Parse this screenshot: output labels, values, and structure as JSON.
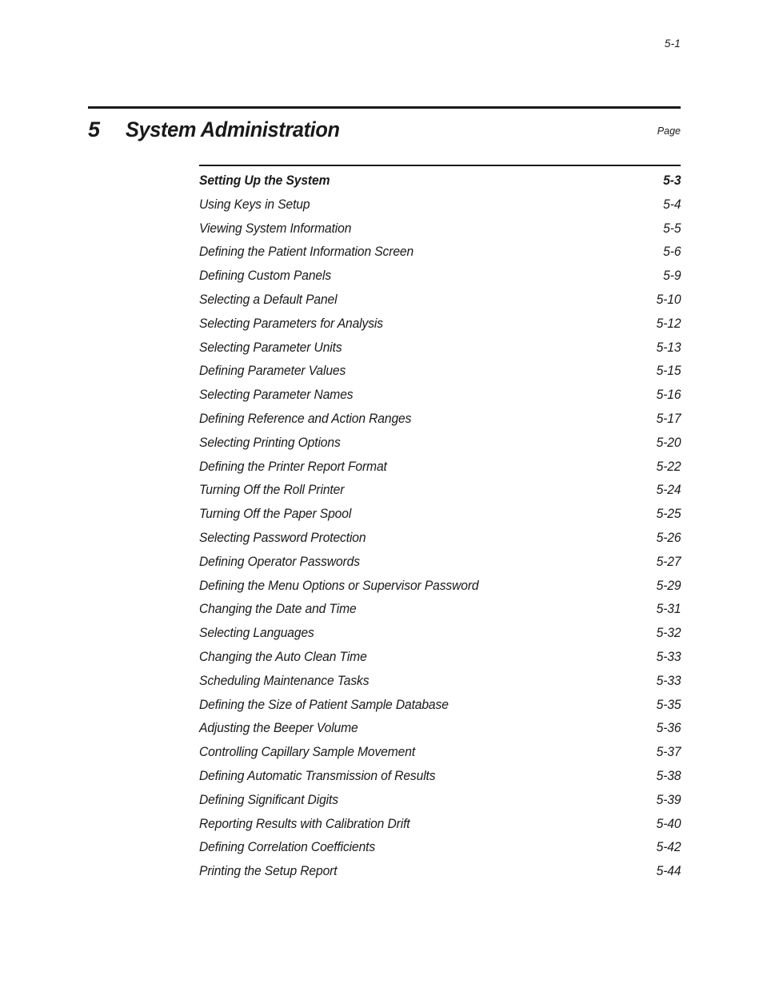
{
  "document": {
    "folio": "5-1",
    "chapter_number": "5",
    "chapter_title": "System Administration",
    "page_column_label": "Page"
  },
  "toc": {
    "entries": [
      {
        "title": "Setting Up the System",
        "page": "5-3",
        "level": "section"
      },
      {
        "title": "Using Keys in Setup",
        "page": "5-4",
        "level": "topic"
      },
      {
        "title": "Viewing System Information",
        "page": "5-5",
        "level": "topic"
      },
      {
        "title": "Defining the Patient Information Screen",
        "page": "5-6",
        "level": "topic"
      },
      {
        "title": "Defining Custom Panels",
        "page": "5-9",
        "level": "topic"
      },
      {
        "title": "Selecting a Default Panel",
        "page": "5-10",
        "level": "topic"
      },
      {
        "title": "Selecting Parameters for Analysis",
        "page": "5-12",
        "level": "topic"
      },
      {
        "title": "Selecting Parameter Units",
        "page": "5-13",
        "level": "topic"
      },
      {
        "title": "Defining Parameter Values",
        "page": "5-15",
        "level": "topic"
      },
      {
        "title": "Selecting Parameter Names",
        "page": "5-16",
        "level": "topic"
      },
      {
        "title": "Defining Reference and Action Ranges",
        "page": "5-17",
        "level": "topic"
      },
      {
        "title": "Selecting Printing Options",
        "page": "5-20",
        "level": "topic"
      },
      {
        "title": "Defining the Printer Report Format",
        "page": "5-22",
        "level": "topic"
      },
      {
        "title": "Turning Off the Roll Printer",
        "page": "5-24",
        "level": "topic"
      },
      {
        "title": "Turning Off the Paper Spool",
        "page": "5-25",
        "level": "topic"
      },
      {
        "title": "Selecting Password Protection",
        "page": "5-26",
        "level": "topic"
      },
      {
        "title": "Defining Operator Passwords",
        "page": "5-27",
        "level": "topic"
      },
      {
        "title": "Defining the Menu Options or Supervisor Password",
        "page": "5-29",
        "level": "topic"
      },
      {
        "title": "Changing the Date and Time",
        "page": "5-31",
        "level": "topic"
      },
      {
        "title": "Selecting Languages",
        "page": "5-32",
        "level": "topic"
      },
      {
        "title": "Changing the Auto Clean Time",
        "page": "5-33",
        "level": "topic"
      },
      {
        "title": "Scheduling Maintenance Tasks",
        "page": "5-33",
        "level": "topic"
      },
      {
        "title": "Defining the Size of Patient Sample Database",
        "page": "5-35",
        "level": "topic"
      },
      {
        "title": "Adjusting the Beeper Volume",
        "page": "5-36",
        "level": "topic"
      },
      {
        "title": "Controlling Capillary Sample Movement",
        "page": "5-37",
        "level": "topic"
      },
      {
        "title": "Defining Automatic Transmission of Results",
        "page": "5-38",
        "level": "topic"
      },
      {
        "title": "Defining Significant Digits",
        "page": "5-39",
        "level": "topic"
      },
      {
        "title": "Reporting Results with Calibration Drift",
        "page": "5-40",
        "level": "topic"
      },
      {
        "title": "Defining Correlation Coefficients",
        "page": "5-42",
        "level": "topic"
      },
      {
        "title": "Printing the Setup Report",
        "page": "5-44",
        "level": "topic"
      }
    ]
  },
  "colors": {
    "ink": "#1a1a1a",
    "paper": "#ffffff"
  }
}
